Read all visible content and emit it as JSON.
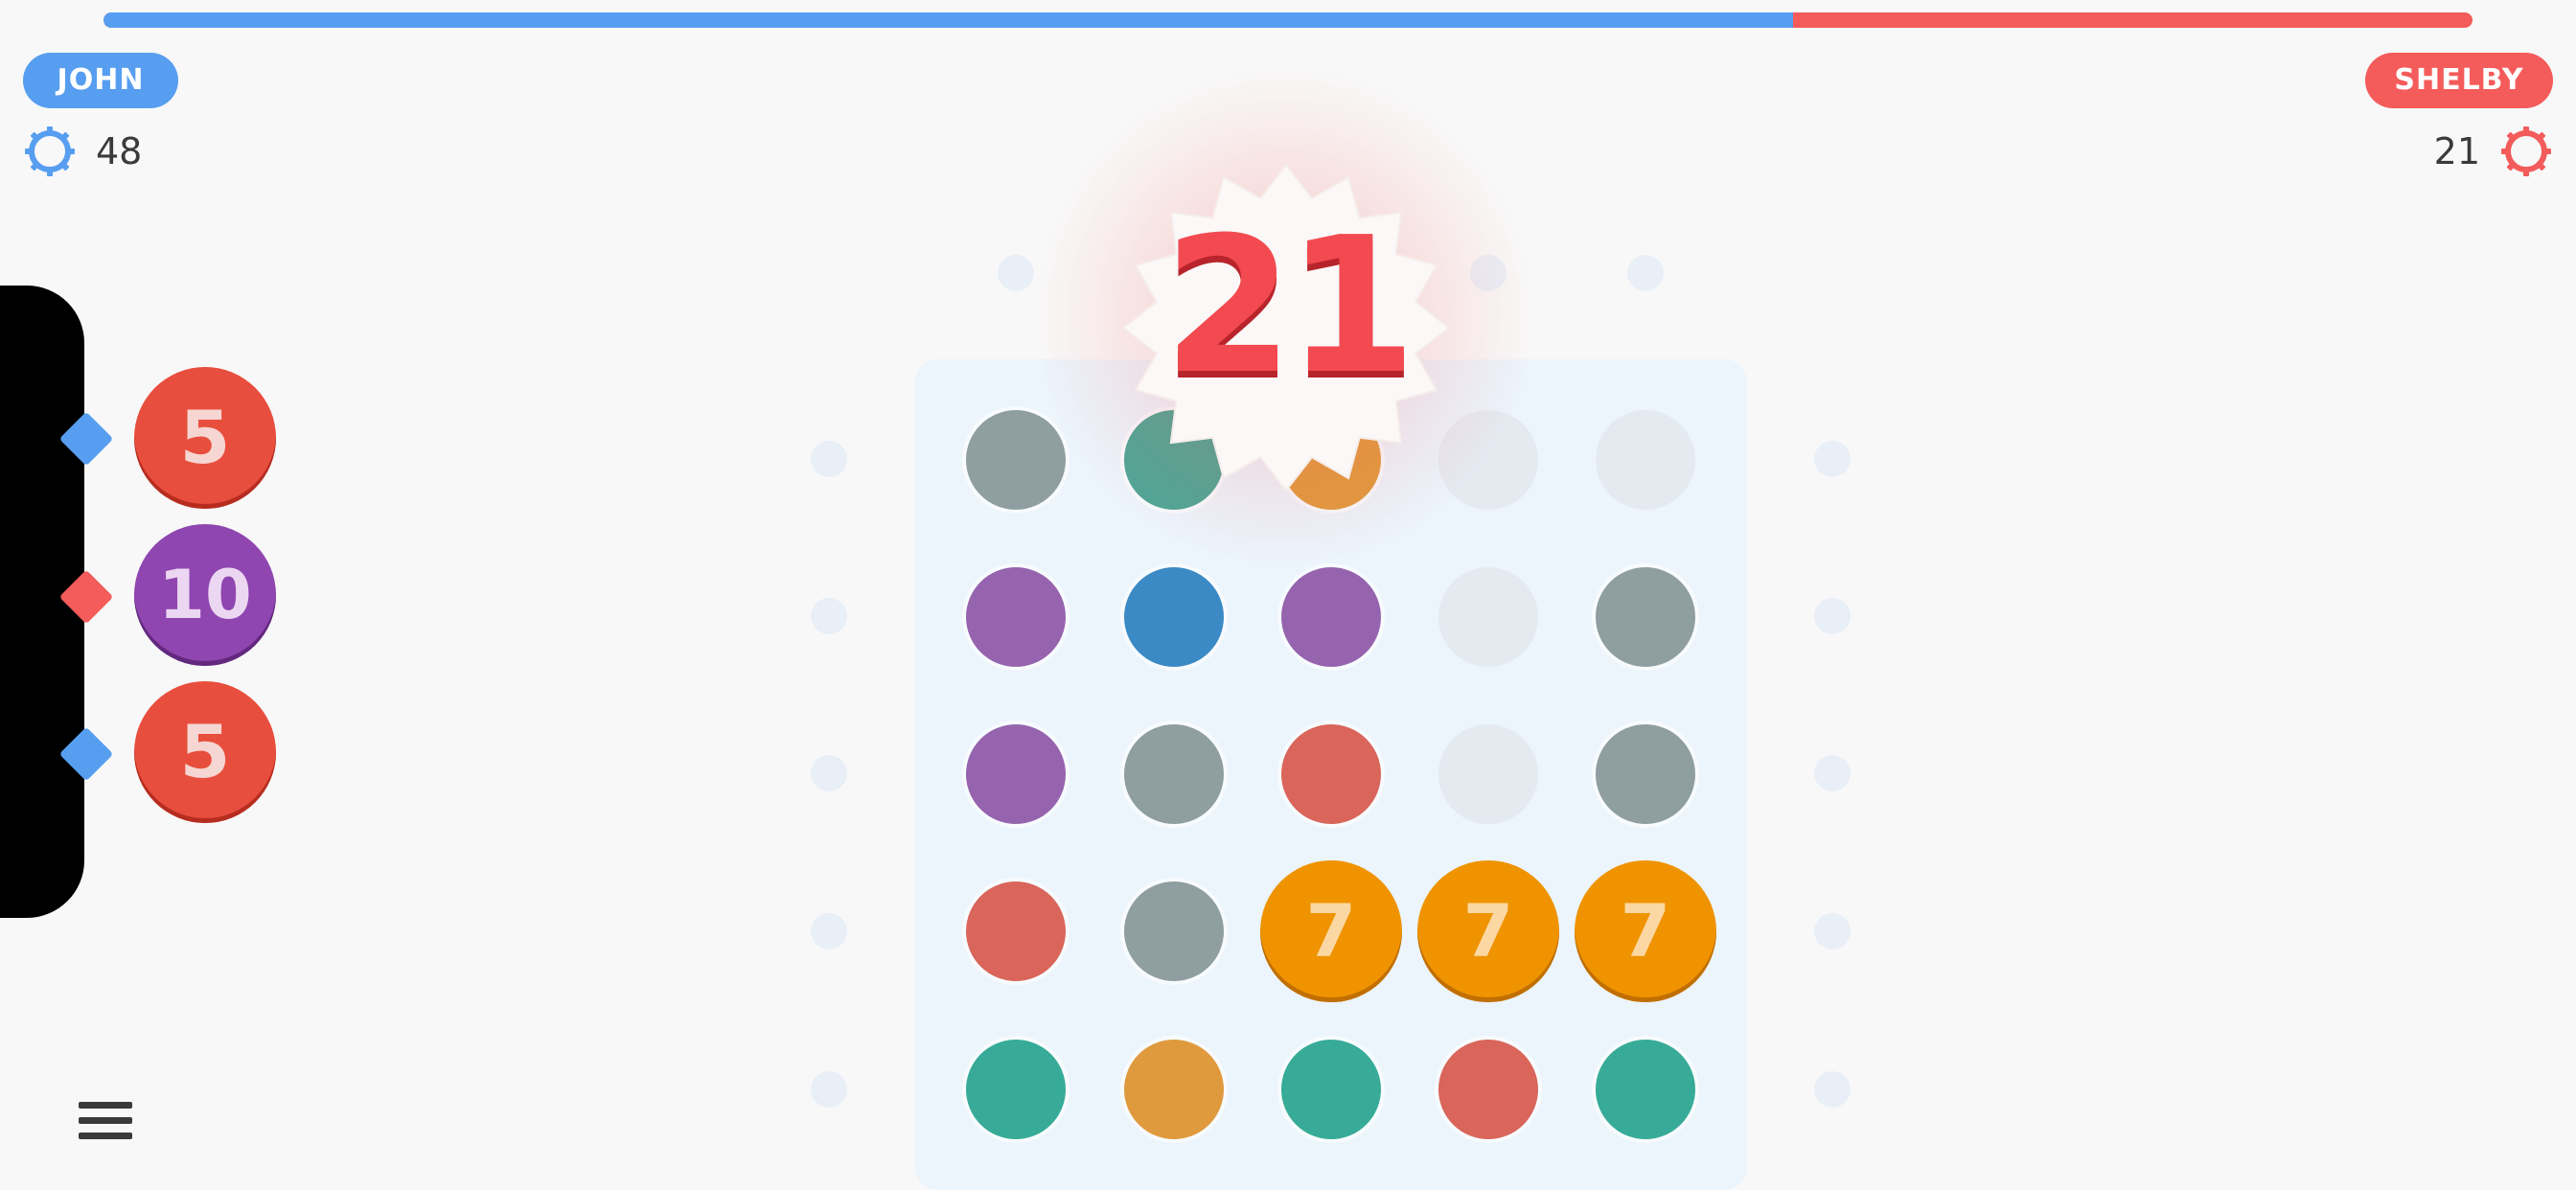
{
  "progress": {
    "value": 0.713
  },
  "players": {
    "left": {
      "name": "JOHN",
      "score": "48",
      "color": "#579ef0"
    },
    "right": {
      "name": "SHELBY",
      "score": "21",
      "color": "#f45b5b"
    }
  },
  "target": {
    "value": "21",
    "color": "#f24a50"
  },
  "queue": [
    {
      "value": "5",
      "color": "red",
      "arrow_color": "#579ef0"
    },
    {
      "value": "10",
      "color": "purple",
      "arrow_color": "#f45b5b"
    },
    {
      "value": "5",
      "color": "red",
      "arrow_color": "#579ef0"
    }
  ],
  "board": {
    "rows": [
      [
        "gray",
        "teal",
        "orange",
        "empty",
        "empty"
      ],
      [
        "purple",
        "blue",
        "purple",
        "empty",
        "gray"
      ],
      [
        "purple",
        "gray",
        "red",
        "empty",
        "gray"
      ],
      [
        "red",
        "gray",
        "big-7",
        "big-7",
        "big-7"
      ],
      [
        "teal",
        "orange",
        "teal",
        "red",
        "teal"
      ]
    ],
    "big_value": "7"
  },
  "icons": {
    "left_gear": "gear-icon",
    "right_gear": "gear-icon",
    "menu": "hamburger-menu-icon"
  }
}
